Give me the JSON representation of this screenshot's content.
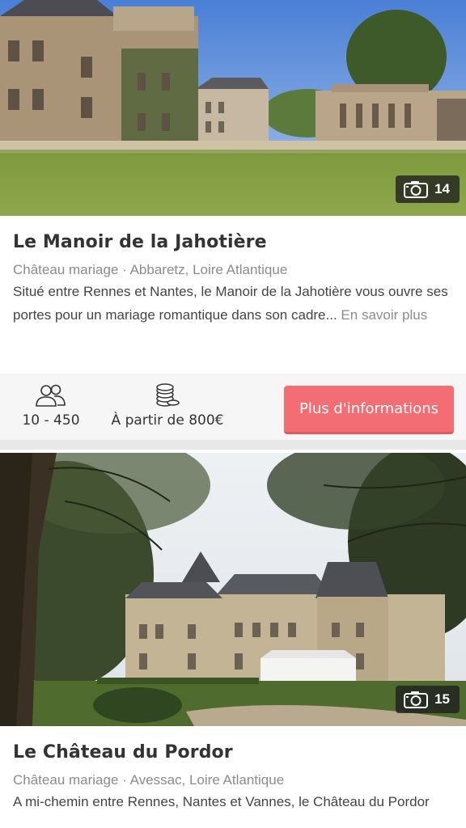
{
  "listings": [
    {
      "title": "Le Manoir de la Jahotière",
      "subtitle": "Château mariage · Abbaretz, Loire Atlantique",
      "description": "Situé entre Rennes et Nantes, le Manoir de la Jahotière vous ouvre ses portes pour un mariage romantique dans son cadre...",
      "more_link": "En savoir plus",
      "photo_count": "14",
      "guests": "10 - 450",
      "price": "À partir de 800€",
      "cta_label": "Plus d'informations",
      "camera_icon": "camera-icon"
    },
    {
      "title": "Le Château du Pordor",
      "subtitle": "Château mariage · Avessac, Loire Atlantique",
      "description": "A mi-chemin entre Rennes, Nantes et Vannes, le Château du Pordor",
      "photo_count": "15",
      "camera_icon": "camera-icon"
    }
  ],
  "icons": {
    "guests": "guests-icon",
    "price": "coins-icon"
  },
  "colors": {
    "cta": "#f26d74",
    "muted": "#8b8b8b",
    "title": "#333333"
  }
}
